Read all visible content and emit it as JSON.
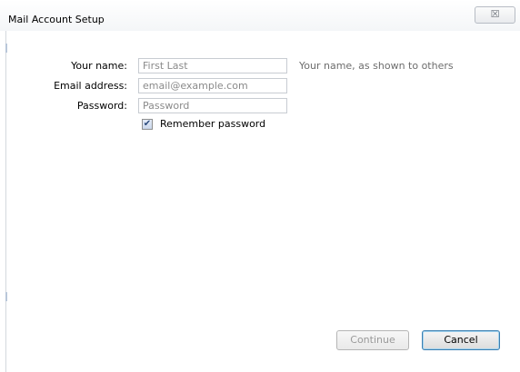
{
  "window": {
    "title": "Mail Account Setup",
    "close_glyph": "☒"
  },
  "form": {
    "name_label": "Your name:",
    "name_placeholder": "First Last",
    "name_hint": "Your name, as shown to others",
    "email_label": "Email address:",
    "email_placeholder": "email@example.com",
    "password_label": "Password:",
    "password_placeholder": "Password",
    "remember_label": "Remember password",
    "remember_checked": true
  },
  "buttons": {
    "continue_label": "Continue",
    "continue_enabled": false,
    "cancel_label": "Cancel"
  }
}
